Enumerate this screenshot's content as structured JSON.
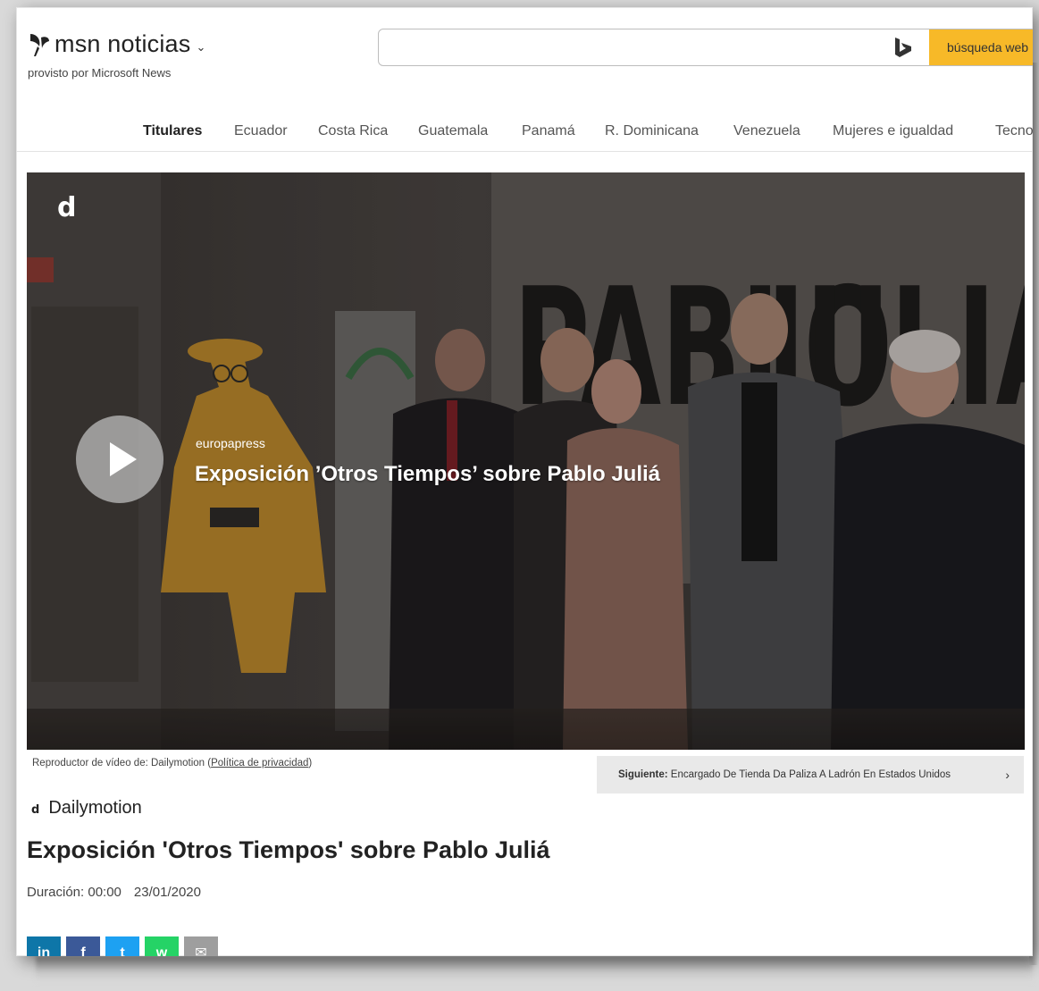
{
  "header": {
    "brand": "msn noticias",
    "brand_sub": "provisto por Microsoft News",
    "search_placeholder": "",
    "search_button": "búsqueda web"
  },
  "nav": {
    "items": [
      {
        "label": "Titulares",
        "active": true
      },
      {
        "label": "Ecuador"
      },
      {
        "label": "Costa Rica"
      },
      {
        "label": "Guatemala"
      },
      {
        "label": "Panamá"
      },
      {
        "label": "R. Dominicana"
      },
      {
        "label": "Venezuela"
      },
      {
        "label": "Mujeres e igualdad"
      },
      {
        "label": "Tecnología"
      }
    ]
  },
  "video": {
    "corner_logo": "d",
    "source": "europapress",
    "title": "Exposición ’Otros Tiempos’ sobre Pablo Juliá"
  },
  "player": {
    "caption_prefix": "Reproductor de vídeo de: Dailymotion (",
    "caption_link": "Política de privacidad",
    "caption_suffix": ")",
    "next_label": "Siguiente:",
    "next_title": "Encargado De Tienda Da Paliza A Ladrón En Estados Unidos",
    "next_chevron": "›"
  },
  "article": {
    "provider_icon": "d",
    "provider": "Dailymotion",
    "title": "Exposición 'Otros Tiempos' sobre Pablo Juliá",
    "duration": "Duración: 00:00",
    "date": "23/01/2020"
  },
  "share": [
    {
      "name": "linkedin",
      "glyph": "in",
      "color": "#0e76a8"
    },
    {
      "name": "facebook",
      "glyph": "f",
      "color": "#3b5998"
    },
    {
      "name": "twitter",
      "glyph": "t",
      "color": "#1da1f2"
    },
    {
      "name": "whatsapp",
      "glyph": "w",
      "color": "#25d366"
    },
    {
      "name": "email",
      "glyph": "✉",
      "color": "#9e9e9e"
    }
  ],
  "colors": {
    "search_button": "#f7b928",
    "next_bar": "#e9e9e9"
  }
}
